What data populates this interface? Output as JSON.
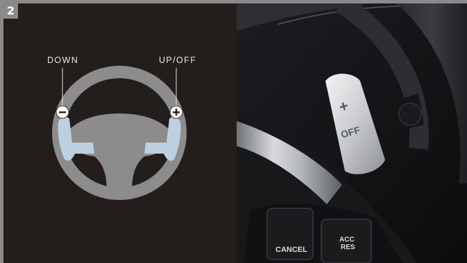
{
  "badge": {
    "number": "2"
  },
  "diagram": {
    "down_label": "DOWN",
    "up_label": "UP/OFF",
    "minus_symbol": "−",
    "plus_symbol": "+"
  },
  "photo": {
    "paddle_top": "+",
    "paddle_bottom": "OFF",
    "cancel_button": "CANCEL",
    "acc_button_line1": "ACC",
    "acc_button_line2": "RES"
  },
  "colors": {
    "panel_background": "#231d1b",
    "wheel_gray": "#8c8c8c",
    "paddle_blue": "#bcd0e0",
    "border_gray": "#8a8a8a"
  },
  "icons": {
    "minus": "minus-circle-icon",
    "plus": "plus-circle-icon"
  }
}
